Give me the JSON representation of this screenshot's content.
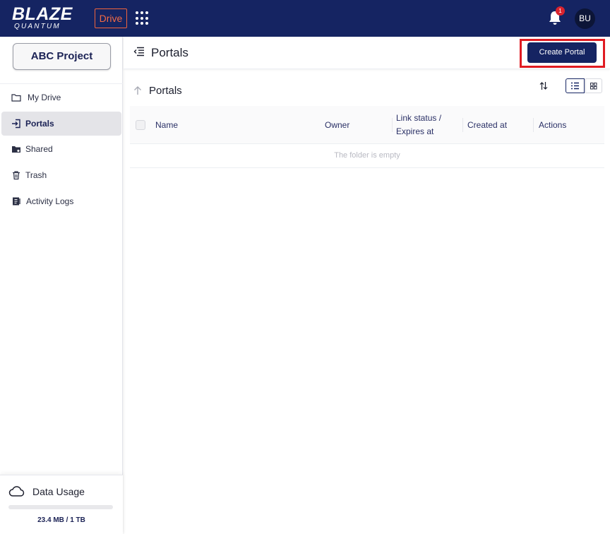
{
  "topbar": {
    "logo_main": "BLAZE",
    "logo_sub": "QUANTUM",
    "app_badge": "Drive",
    "notification_count": "1",
    "avatar_initials": "BU"
  },
  "sidebar": {
    "project_name": "ABC Project",
    "items": [
      {
        "label": "My Drive",
        "icon": "folder-icon",
        "active": false
      },
      {
        "label": "Portals",
        "icon": "portal-icon",
        "active": true
      },
      {
        "label": "Shared",
        "icon": "shared-folder-icon",
        "active": false
      },
      {
        "label": "Trash",
        "icon": "trash-icon",
        "active": false
      },
      {
        "label": "Activity Logs",
        "icon": "activity-log-icon",
        "active": false
      }
    ],
    "usage": {
      "title": "Data Usage",
      "text": "23.4 MB / 1 TB",
      "used_fraction": 2.34e-05
    }
  },
  "header": {
    "title": "Portals",
    "create_button": "Create Portal"
  },
  "content": {
    "title": "Portals",
    "view_mode": "list",
    "columns": [
      "Name",
      "Owner",
      "Link status / Expires at",
      "Created at",
      "Actions"
    ],
    "empty_message": "The folder is empty"
  },
  "colors": {
    "brand_navy": "#152462",
    "accent_orange": "#f26a45",
    "badge_red": "#d9232e",
    "highlight_red": "#e01b22"
  }
}
